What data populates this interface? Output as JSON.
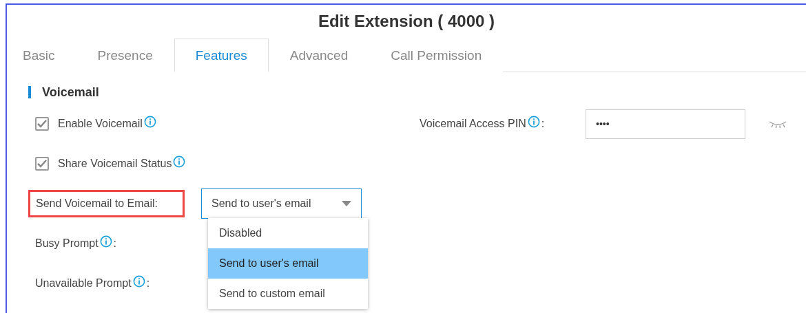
{
  "window": {
    "title": "Edit Extension ( 4000 )"
  },
  "tabs": [
    {
      "label": "Basic",
      "selected": false
    },
    {
      "label": "Presence",
      "selected": false
    },
    {
      "label": "Features",
      "selected": true
    },
    {
      "label": "Advanced",
      "selected": false
    },
    {
      "label": "Call Permission",
      "selected": false
    }
  ],
  "section": {
    "title": "Voicemail"
  },
  "checkboxes": [
    {
      "label": "Enable Voicemail",
      "checked": true
    },
    {
      "label": "Share Voicemail Status",
      "checked": true
    }
  ],
  "pin": {
    "label": "Voicemail Access PIN",
    "colon": ":",
    "value": "••••"
  },
  "send_to_email": {
    "label": "Send Voicemail to Email:",
    "highlighted": true,
    "value": "Send to user's email",
    "expanded": true,
    "options": [
      {
        "label": "Disabled",
        "selected": false
      },
      {
        "label": "Send to user's email",
        "selected": true
      },
      {
        "label": "Send to custom email",
        "selected": false
      }
    ]
  },
  "prompts": [
    {
      "label": "Busy Prompt",
      "colon": ":"
    },
    {
      "label": "Unavailable Prompt",
      "colon": ":"
    }
  ]
}
